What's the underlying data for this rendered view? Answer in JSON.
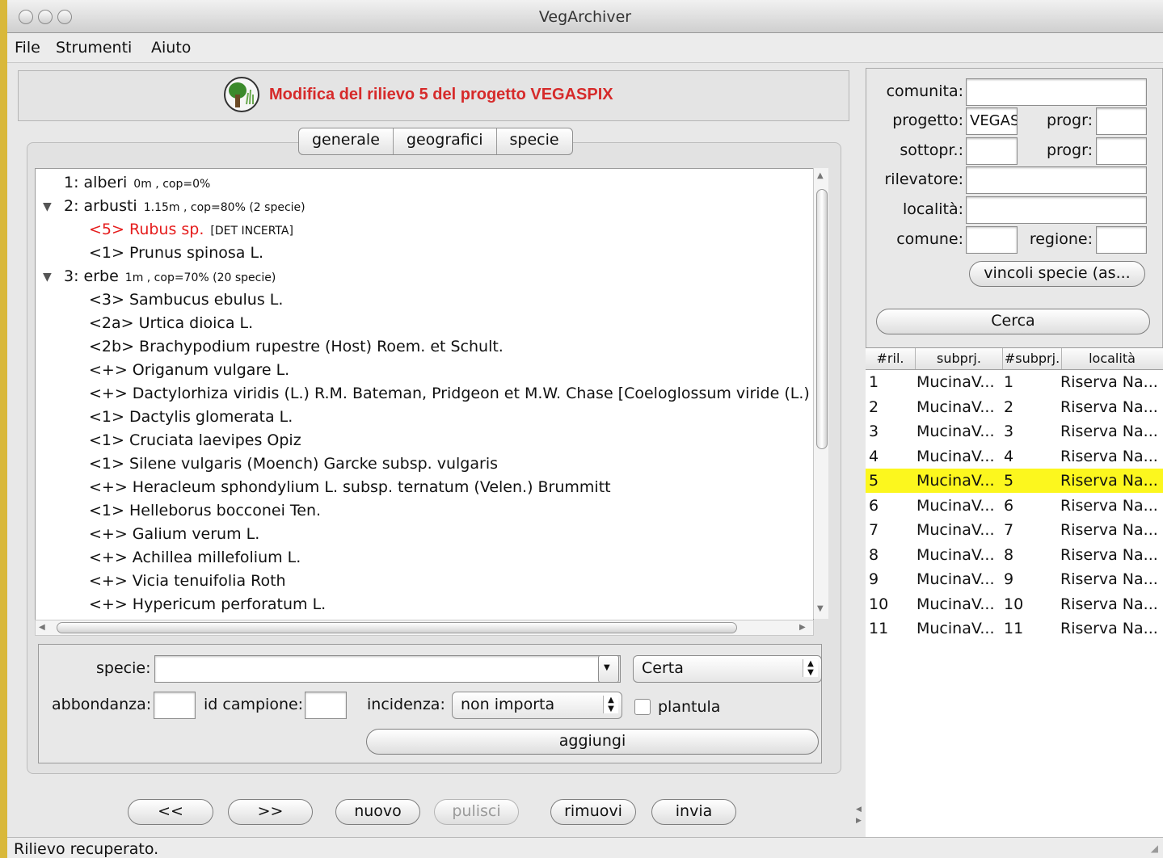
{
  "window": {
    "title": "VegArchiver"
  },
  "menu": [
    "File",
    "Strumenti",
    "Aiuto"
  ],
  "header": {
    "title": "Modifica del rilievo 5 del progetto VEGASPIX",
    "logo_icon": "tree-icon"
  },
  "tabs": [
    "generale",
    "geografici",
    "specie"
  ],
  "tree": [
    {
      "expanded": null,
      "main": "1: alberi",
      "extra": "0m , cop=0%"
    },
    {
      "expanded": true,
      "main": "2: arbusti",
      "extra": "1.15m , cop=80%  (2 specie)"
    },
    {
      "child": true,
      "red": true,
      "main": "<5> Rubus sp.",
      "extra": "[DET INCERTA]"
    },
    {
      "child": true,
      "main": "<1> Prunus spinosa L.",
      "extra": ""
    },
    {
      "expanded": true,
      "main": "3: erbe",
      "extra": "1m , cop=70%  (20 specie)"
    },
    {
      "child": true,
      "main": "<3> Sambucus ebulus L.",
      "extra": ""
    },
    {
      "child": true,
      "main": "<2a> Urtica dioica L.",
      "extra": ""
    },
    {
      "child": true,
      "main": "<2b> Brachypodium rupestre (Host) Roem. et Schult.",
      "extra": ""
    },
    {
      "child": true,
      "main": "<+> Origanum vulgare L.",
      "extra": ""
    },
    {
      "child": true,
      "main": "<+> Dactylorhiza viridis (L.) R.M. Bateman, Pridgeon et M.W. Chase [Coeloglossum viride (L.) H",
      "extra": ""
    },
    {
      "child": true,
      "main": "<1> Dactylis glomerata L.",
      "extra": ""
    },
    {
      "child": true,
      "main": "<1> Cruciata laevipes Opiz",
      "extra": ""
    },
    {
      "child": true,
      "main": "<1> Silene vulgaris (Moench) Garcke subsp. vulgaris",
      "extra": ""
    },
    {
      "child": true,
      "main": "<+> Heracleum sphondylium L. subsp. ternatum (Velen.) Brummitt",
      "extra": ""
    },
    {
      "child": true,
      "main": "<1> Helleborus bocconei Ten.",
      "extra": ""
    },
    {
      "child": true,
      "main": "<+> Galium verum L.",
      "extra": ""
    },
    {
      "child": true,
      "main": "<+> Achillea millefolium L.",
      "extra": ""
    },
    {
      "child": true,
      "main": "<+> Vicia tenuifolia Roth",
      "extra": ""
    },
    {
      "child": true,
      "main": "<+> Hypericum perforatum L.",
      "extra": ""
    }
  ],
  "form": {
    "specie_label": "specie:",
    "specie_value": "",
    "certainty": "Certa",
    "abbondanza_label": "abbondanza:",
    "id_campione_label": "id campione:",
    "incidenza_label": "incidenza:",
    "incidenza_value": "non importa",
    "plantula_label": "plantula",
    "plantula_checked": false,
    "aggiungi_label": "aggiungi"
  },
  "buttons": {
    "prev": "<<",
    "next": ">>",
    "nuovo": "nuovo",
    "pulisci": "pulisci",
    "rimuovi": "rimuovi",
    "invia": "invia"
  },
  "search": {
    "comunita_label": "comunita:",
    "progetto_label": "progetto:",
    "progetto_value": "VEGASPIX",
    "progr_label": "progr:",
    "sottopr_label": "sottopr.:",
    "progr2_label": "progr:",
    "rilevatore_label": "rilevatore:",
    "localita_label": "località:",
    "comune_label": "comune:",
    "regione_label": "regione:",
    "vincoli_label": "vincoli specie (as...",
    "cerca_label": "Cerca"
  },
  "results": {
    "columns": [
      "#ril.",
      "subprj.",
      "#subprj.",
      "località"
    ],
    "selected_index": 4,
    "rows": [
      {
        "ril": "1",
        "subprj": "MucinaV...",
        "nsub": "1",
        "loc": "Riserva Na..."
      },
      {
        "ril": "2",
        "subprj": "MucinaV...",
        "nsub": "2",
        "loc": "Riserva Na..."
      },
      {
        "ril": "3",
        "subprj": "MucinaV...",
        "nsub": "3",
        "loc": "Riserva Na..."
      },
      {
        "ril": "4",
        "subprj": "MucinaV...",
        "nsub": "4",
        "loc": "Riserva Na..."
      },
      {
        "ril": "5",
        "subprj": "MucinaV...",
        "nsub": "5",
        "loc": "Riserva Na..."
      },
      {
        "ril": "6",
        "subprj": "MucinaV...",
        "nsub": "6",
        "loc": "Riserva Na..."
      },
      {
        "ril": "7",
        "subprj": "MucinaV...",
        "nsub": "7",
        "loc": "Riserva Na..."
      },
      {
        "ril": "8",
        "subprj": "MucinaV...",
        "nsub": "8",
        "loc": "Riserva Na..."
      },
      {
        "ril": "9",
        "subprj": "MucinaV...",
        "nsub": "9",
        "loc": "Riserva Na..."
      },
      {
        "ril": "10",
        "subprj": "MucinaV...",
        "nsub": "10",
        "loc": "Riserva Na..."
      },
      {
        "ril": "11",
        "subprj": "MucinaV...",
        "nsub": "11",
        "loc": "Riserva Na..."
      }
    ]
  },
  "status": {
    "text": "Rilievo recuperato."
  },
  "colors": {
    "title_red": "#d62a2a",
    "species_red": "#e51c1c",
    "selection": "#fcf71e"
  }
}
